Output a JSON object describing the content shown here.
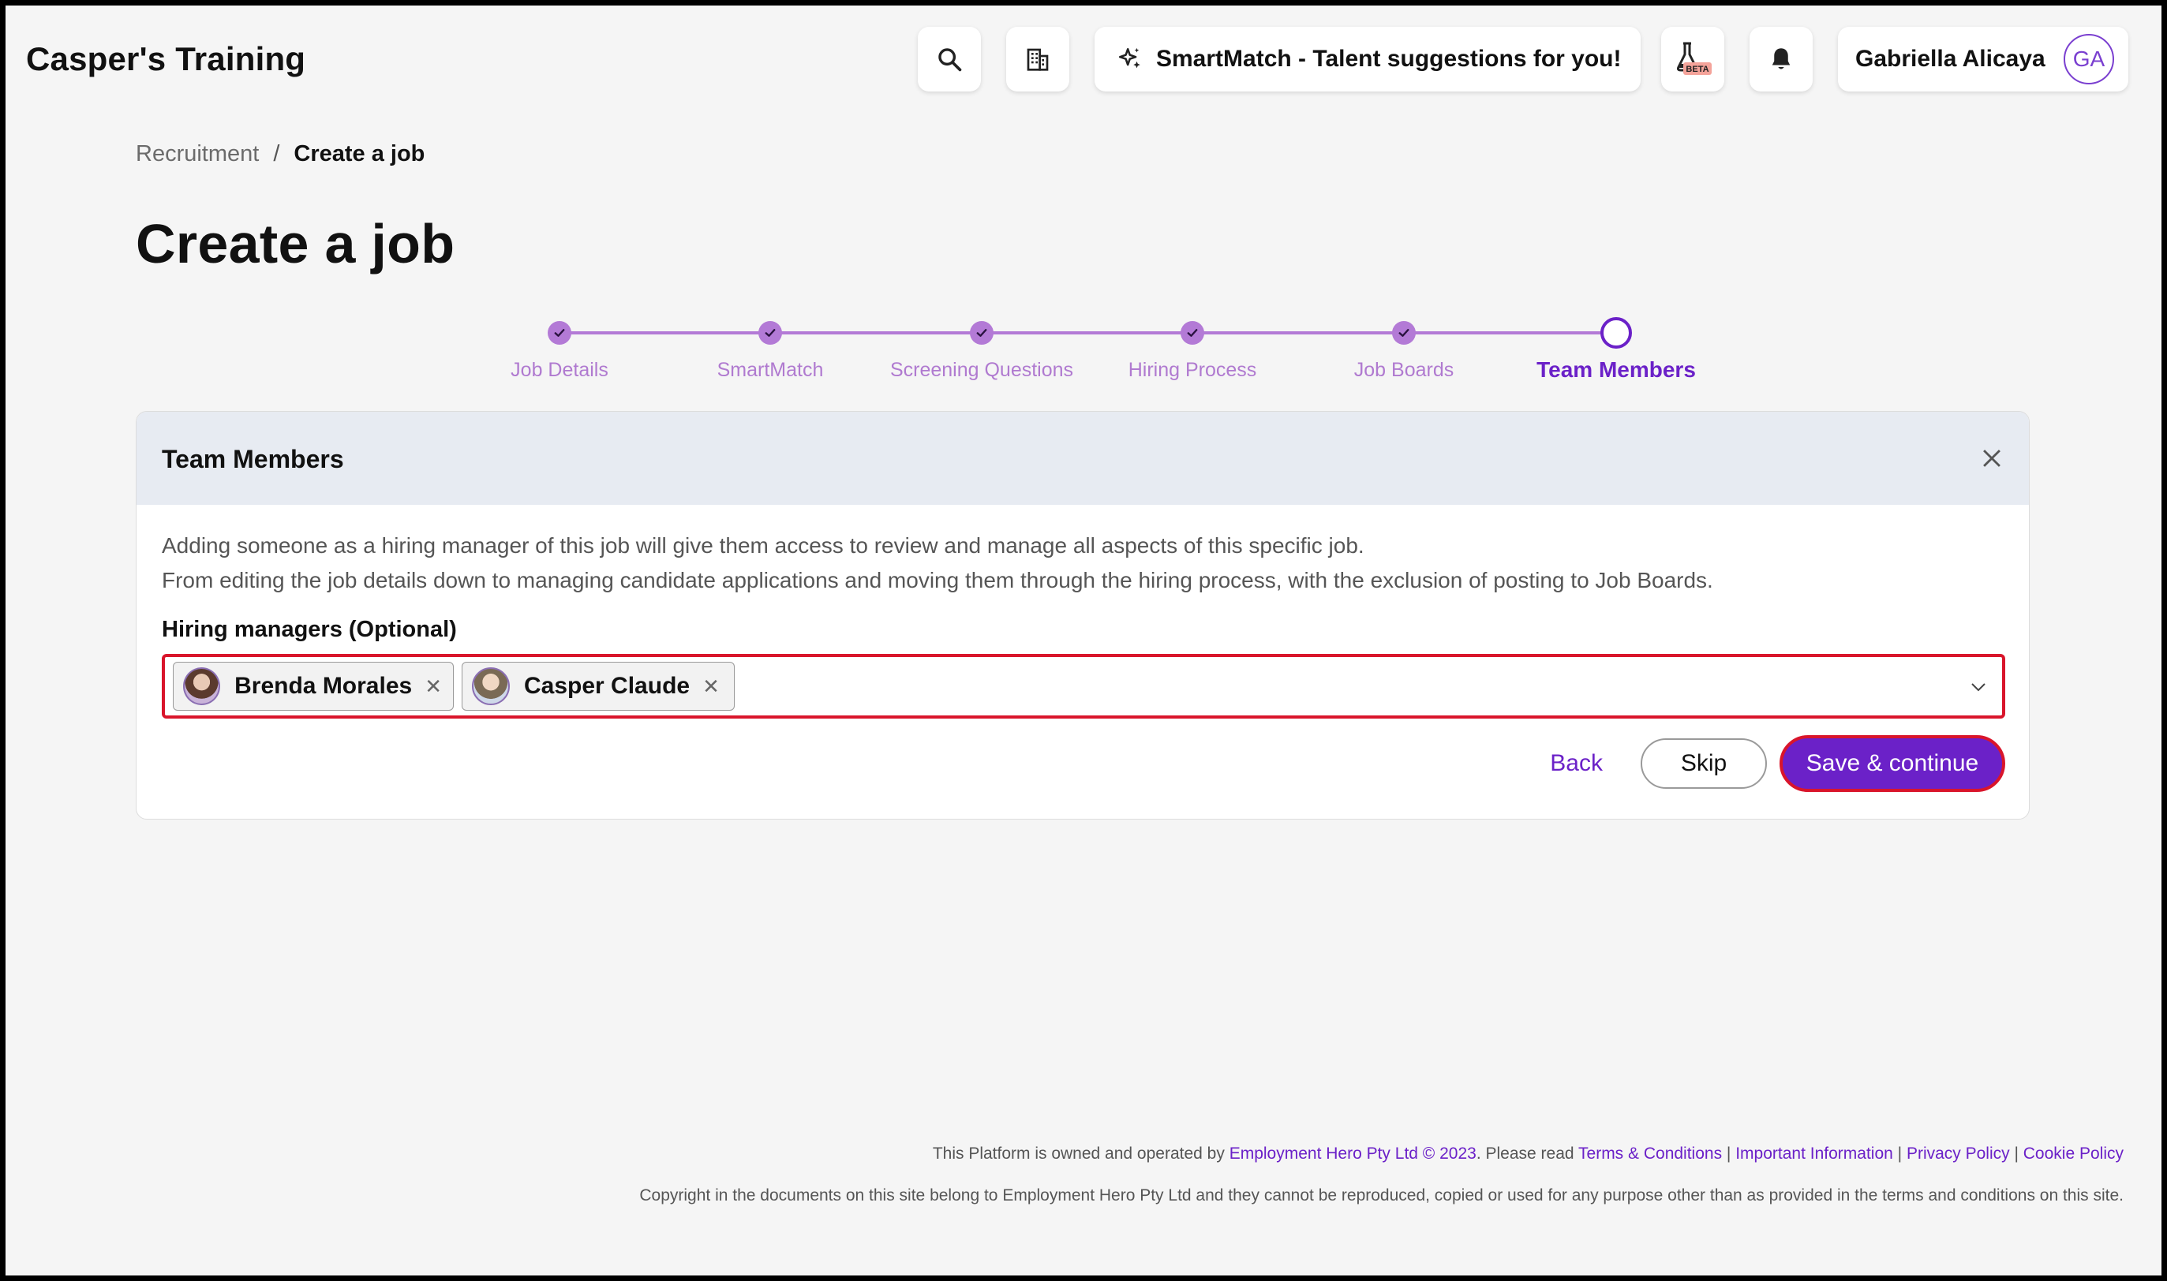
{
  "app": {
    "title": "Casper's Training"
  },
  "header": {
    "smartmatch_label": "SmartMatch - Talent suggestions for you!",
    "beta_badge": "BETA",
    "user_name": "Gabriella Alicaya",
    "user_initials": "GA"
  },
  "breadcrumb": {
    "parent": "Recruitment",
    "separator": "/",
    "current": "Create a job"
  },
  "page": {
    "title": "Create a job"
  },
  "stepper": {
    "steps": [
      {
        "label": "Job Details",
        "status": "done"
      },
      {
        "label": "SmartMatch",
        "status": "done"
      },
      {
        "label": "Screening Questions",
        "status": "done"
      },
      {
        "label": "Hiring Process",
        "status": "done"
      },
      {
        "label": "Job Boards",
        "status": "done"
      },
      {
        "label": "Team Members",
        "status": "current"
      }
    ]
  },
  "card": {
    "title": "Team Members",
    "description_line1": "Adding someone as a hiring manager of this job will give them access to review and manage all aspects of this specific job.",
    "description_line2": "From editing the job details down to managing candidate applications and moving them through the hiring process, with the exclusion of posting to Job Boards.",
    "field_label": "Hiring managers (Optional)",
    "selected_managers": [
      "Brenda Morales",
      "Casper Claude"
    ],
    "back_label": "Back",
    "skip_label": "Skip",
    "save_label": "Save & continue"
  },
  "footer": {
    "line1_prefix": "This Platform is owned and operated by ",
    "company_link": "Employment Hero Pty Ltd © 2023",
    "line1_mid": ". Please read ",
    "links": [
      "Terms & Conditions",
      "Important Information",
      "Privacy Policy",
      "Cookie Policy"
    ],
    "link_separator": " | ",
    "line2": "Copyright in the documents on this site belong to Employment Hero Pty Ltd and they cannot be reproduced, copied or used for any purpose other than as provided in the terms and conditions on this site."
  },
  "colors": {
    "accent": "#6b21c8",
    "step_done": "#b37ad6",
    "highlight_border": "#d9152b",
    "card_header_bg": "#e7ebf2"
  }
}
